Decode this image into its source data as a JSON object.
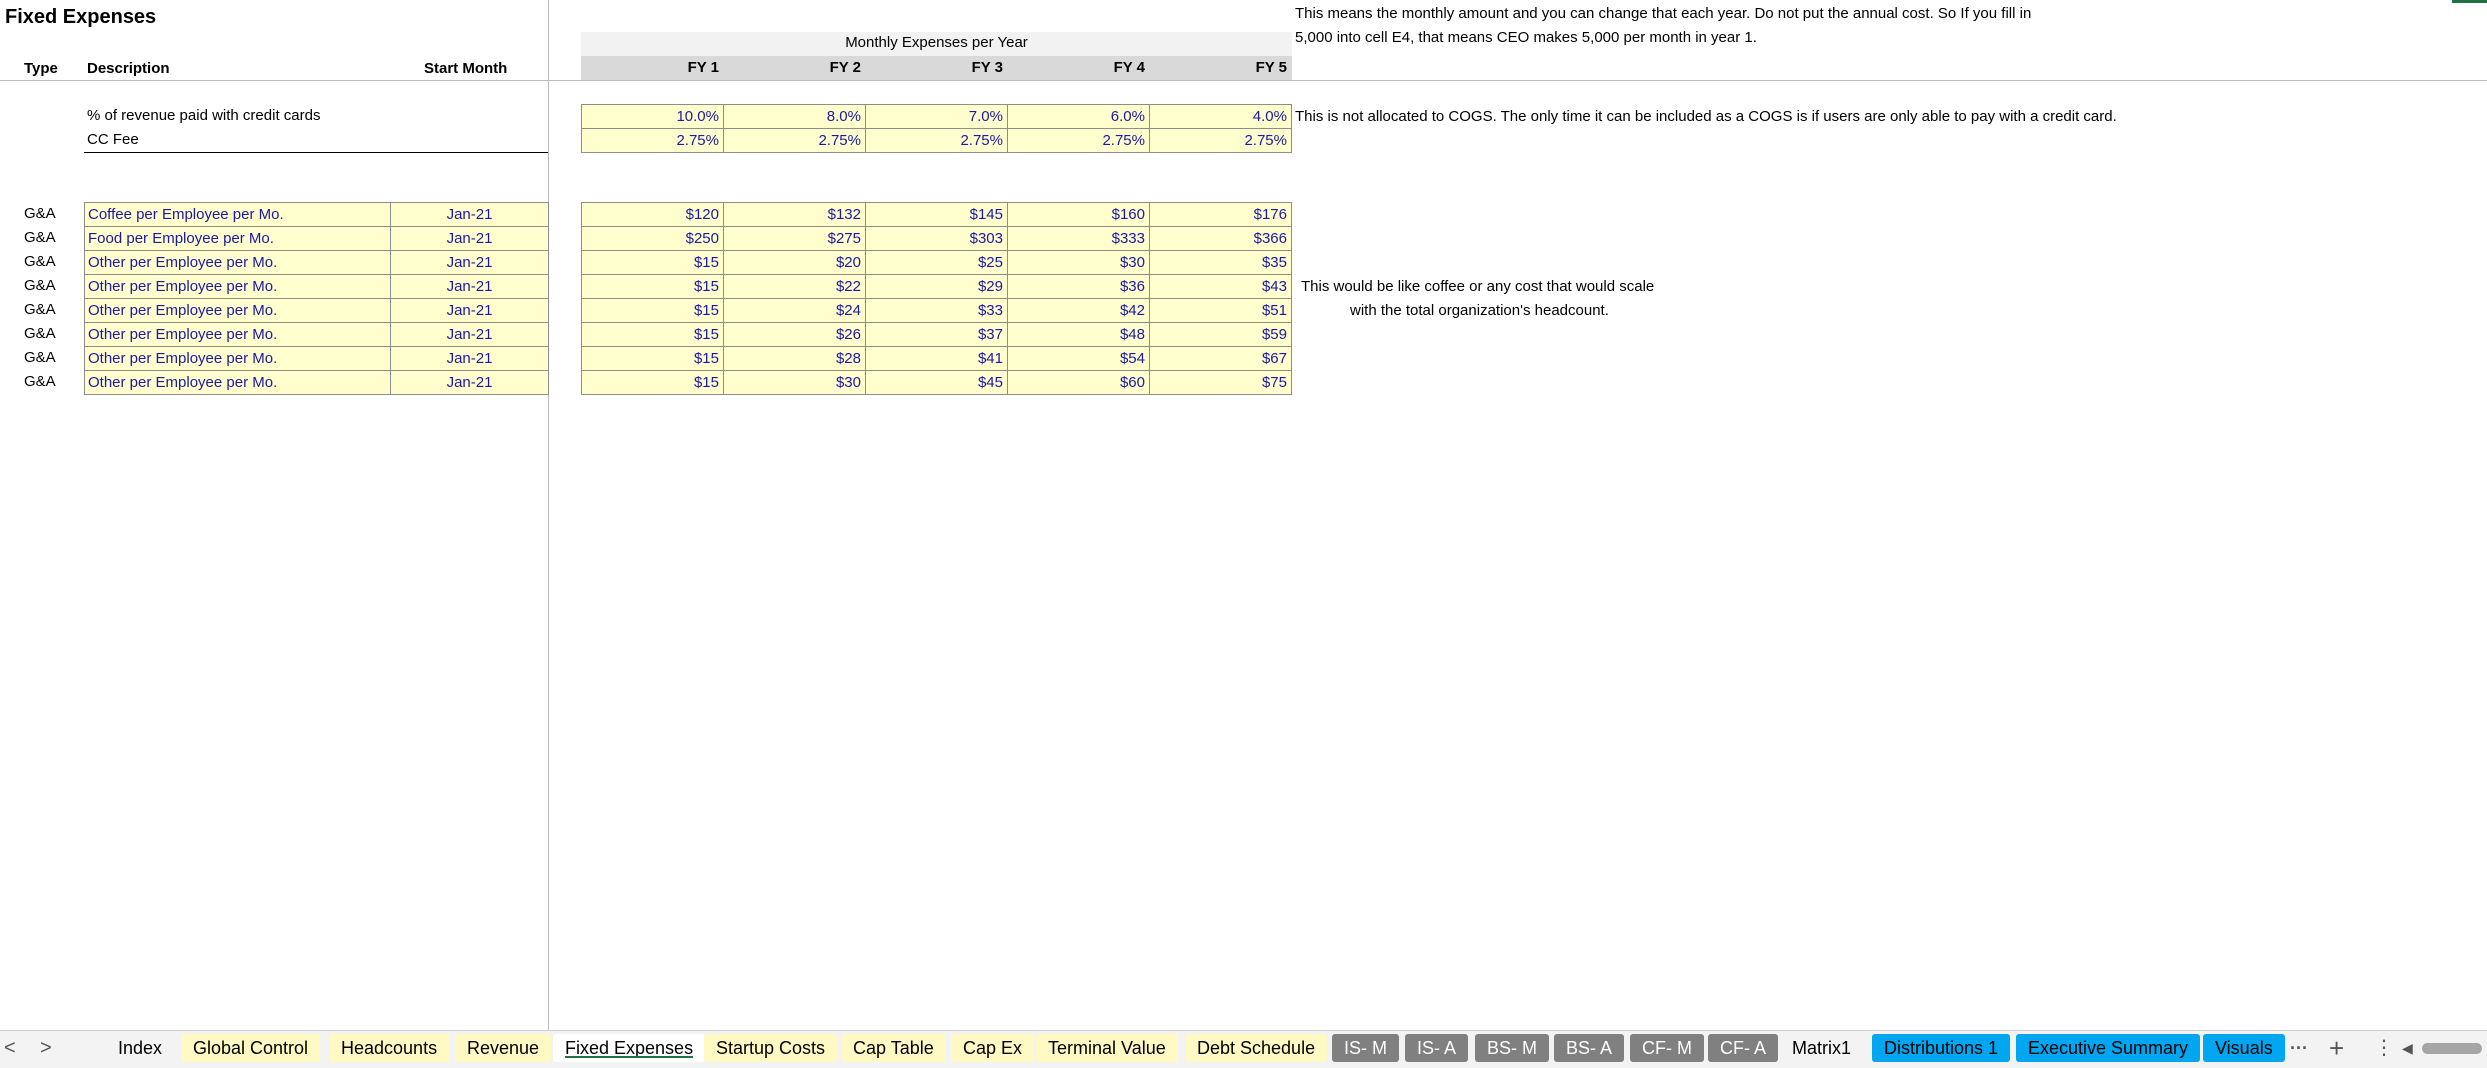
{
  "sheet": {
    "title": "Fixed Expenses",
    "headers": {
      "type": "Type",
      "description": "Description",
      "start_month": "Start Month"
    },
    "band_label": "Monthly Expenses per Year",
    "fy_headers": [
      "FY 1",
      "FY 2",
      "FY 3",
      "FY 4",
      "FY 5"
    ],
    "top_note_line1": "This means the monthly amount and you can change that each year. Do not put the annual cost. So If you fill in",
    "top_note_line2": "5,000 into cell E4, that means CEO makes 5,000 per month in year 1.",
    "credit": {
      "pct_label": "% of revenue paid with credit cards",
      "fee_label": "CC Fee",
      "pct_values": [
        "10.0%",
        "8.0%",
        "7.0%",
        "6.0%",
        "4.0%"
      ],
      "fee_values": [
        "2.75%",
        "2.75%",
        "2.75%",
        "2.75%",
        "2.75%"
      ],
      "note": "This is not allocated to COGS. The only time it can be included as a COGS is if users are only able to pay with a credit card."
    },
    "expense_rows": [
      {
        "type": "G&A",
        "description": "Coffee per Employee per Mo.",
        "start": "Jan-21",
        "values": [
          "$120",
          "$132",
          "$145",
          "$160",
          "$176"
        ]
      },
      {
        "type": "G&A",
        "description": "Food per Employee per Mo.",
        "start": "Jan-21",
        "values": [
          "$250",
          "$275",
          "$303",
          "$333",
          "$366"
        ]
      },
      {
        "type": "G&A",
        "description": "Other per Employee per Mo.",
        "start": "Jan-21",
        "values": [
          "$15",
          "$20",
          "$25",
          "$30",
          "$35"
        ]
      },
      {
        "type": "G&A",
        "description": "Other per Employee per Mo.",
        "start": "Jan-21",
        "values": [
          "$15",
          "$22",
          "$29",
          "$36",
          "$43"
        ]
      },
      {
        "type": "G&A",
        "description": "Other per Employee per Mo.",
        "start": "Jan-21",
        "values": [
          "$15",
          "$24",
          "$33",
          "$42",
          "$51"
        ]
      },
      {
        "type": "G&A",
        "description": "Other per Employee per Mo.",
        "start": "Jan-21",
        "values": [
          "$15",
          "$26",
          "$37",
          "$48",
          "$59"
        ]
      },
      {
        "type": "G&A",
        "description": "Other per Employee per Mo.",
        "start": "Jan-21",
        "values": [
          "$15",
          "$28",
          "$41",
          "$54",
          "$67"
        ]
      },
      {
        "type": "G&A",
        "description": "Other per Employee per Mo.",
        "start": "Jan-21",
        "values": [
          "$15",
          "$30",
          "$45",
          "$60",
          "$75"
        ]
      }
    ],
    "side_note_line1": "This would be like coffee or any cost that would scale",
    "side_note_line2": "with the total organization's headcount."
  },
  "tabs": [
    {
      "label": "Index",
      "style": "yellow"
    },
    {
      "label": "Global Control",
      "style": "yellow"
    },
    {
      "label": "Headcounts",
      "style": "yellow"
    },
    {
      "label": "Revenue",
      "style": "yellow"
    },
    {
      "label": "Fixed Expenses",
      "style": "active"
    },
    {
      "label": "Startup Costs",
      "style": "yellow"
    },
    {
      "label": "Cap Table",
      "style": "yellow"
    },
    {
      "label": "Cap Ex",
      "style": "yellow"
    },
    {
      "label": "Terminal Value",
      "style": "yellow"
    },
    {
      "label": "Debt Schedule",
      "style": "yellow"
    },
    {
      "label": "IS- M",
      "style": "gray"
    },
    {
      "label": "IS- A",
      "style": "gray"
    },
    {
      "label": "BS- M",
      "style": "gray"
    },
    {
      "label": "BS- A",
      "style": "gray"
    },
    {
      "label": "CF- M",
      "style": "gray"
    },
    {
      "label": "CF- A",
      "style": "gray"
    },
    {
      "label": "Matrix1",
      "style": "plain"
    },
    {
      "label": "Distributions 1",
      "style": "blue"
    },
    {
      "label": "Executive Summary",
      "style": "blue"
    },
    {
      "label": "Visuals",
      "style": "blue"
    }
  ],
  "controls": {
    "prev_icon": "chevron-left-icon",
    "next_icon": "chevron-right-icon",
    "more_icon": "more-tabs-icon",
    "add_icon": "add-sheet-icon",
    "options_icon": "vertical-dots-icon",
    "scroll_icon": "scroll-left-icon",
    "prev_glyph": "<",
    "next_glyph": ">",
    "more_glyph": "···",
    "add_glyph": "+",
    "options_glyph": "⋮",
    "scroll_glyph": "◀"
  }
}
